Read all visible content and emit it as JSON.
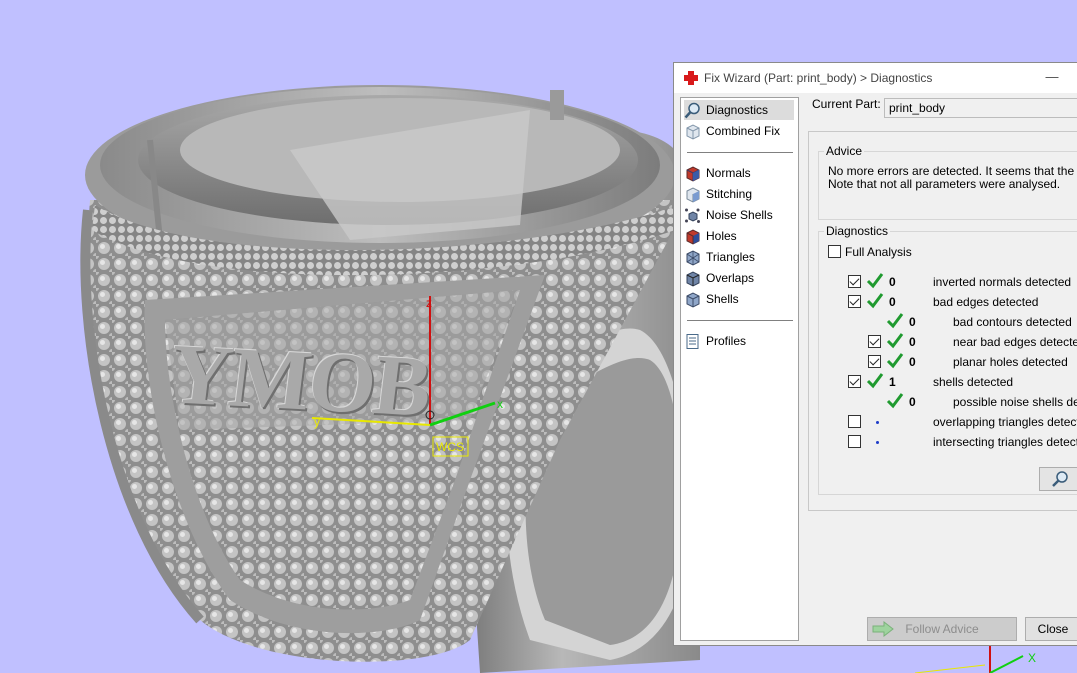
{
  "viewport": {
    "ring_text": "YMOB",
    "axis_labels": {
      "z": "z",
      "y": "y",
      "x": "x"
    },
    "wcs_label": "WCS",
    "corner_axis_x": "X",
    "background_color": "#c0c0ff"
  },
  "dialog": {
    "title": "Fix Wizard (Part: print_body) > Diagnostics",
    "minimize": "—",
    "nav": {
      "group1": [
        {
          "label": "Diagnostics",
          "icon": "magnifier-icon",
          "selected": true
        },
        {
          "label": "Combined Fix",
          "icon": "cube-icon"
        }
      ],
      "group2": [
        {
          "label": "Normals",
          "icon": "normals-icon"
        },
        {
          "label": "Stitching",
          "icon": "stitching-icon"
        },
        {
          "label": "Noise Shells",
          "icon": "noise-shells-icon"
        },
        {
          "label": "Holes",
          "icon": "holes-icon"
        },
        {
          "label": "Triangles",
          "icon": "triangles-icon"
        },
        {
          "label": "Overlaps",
          "icon": "overlaps-icon"
        },
        {
          "label": "Shells",
          "icon": "shells-icon"
        }
      ],
      "group3": [
        {
          "label": "Profiles",
          "icon": "profiles-icon"
        }
      ]
    },
    "current_part_label": "Current Part:",
    "current_part_value": "print_body",
    "advice": {
      "title": "Advice",
      "line1": "No more errors are detected. It seems that the part",
      "line2": "Note that not all parameters were analysed."
    },
    "diagnostics": {
      "title": "Diagnostics",
      "full_analysis_label": "Full Analysis",
      "full_analysis_checked": false,
      "rows": [
        {
          "label": "inverted normals detected",
          "value": "0",
          "checked": true,
          "status": "ok"
        },
        {
          "label": "bad edges detected",
          "value": "0",
          "checked": true,
          "status": "ok"
        },
        {
          "label": "bad contours detected",
          "value": "0",
          "status": "ok"
        },
        {
          "label": "near bad edges detected",
          "value": "0",
          "checked": true,
          "status": "ok"
        },
        {
          "label": "planar holes detected",
          "value": "0",
          "checked": true,
          "status": "ok"
        },
        {
          "label": "shells detected",
          "value": "1",
          "checked": true,
          "status": "ok"
        },
        {
          "label": "possible noise shells detec",
          "value": "0",
          "status": "ok"
        },
        {
          "label": "overlapping triangles detected",
          "checked": false,
          "status": "pending"
        },
        {
          "label": "intersecting triangles detected",
          "checked": false,
          "status": "pending"
        }
      ]
    },
    "buttons": {
      "follow_advice": "Follow Advice",
      "close": "Close",
      "search_icon": "magnifier-icon"
    },
    "colors": {
      "ok_tick": "#1f9a2f",
      "pending_dot": "#1d3cc9",
      "title_icon": "#d8191b"
    }
  }
}
